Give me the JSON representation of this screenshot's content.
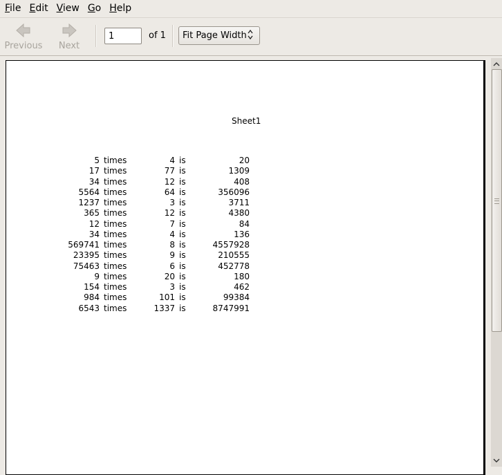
{
  "menu": {
    "items": [
      {
        "mnemonic": "F",
        "rest": "ile"
      },
      {
        "mnemonic": "E",
        "rest": "dit"
      },
      {
        "mnemonic": "V",
        "rest": "iew"
      },
      {
        "mnemonic": "G",
        "rest": "o"
      },
      {
        "mnemonic": "H",
        "rest": "elp"
      }
    ]
  },
  "toolbar": {
    "previous_label": "Previous",
    "next_label": "Next",
    "page_value": "1",
    "of_label": "of 1",
    "zoom_value": "Fit Page Width"
  },
  "document": {
    "sheet_title": "Sheet1",
    "rows": [
      {
        "a": "5",
        "times": "times",
        "b": "4",
        "is": "is",
        "result": "20"
      },
      {
        "a": "17",
        "times": "times",
        "b": "77",
        "is": "is",
        "result": "1309"
      },
      {
        "a": "34",
        "times": "times",
        "b": "12",
        "is": "is",
        "result": "408"
      },
      {
        "a": "5564",
        "times": "times",
        "b": "64",
        "is": "is",
        "result": "356096"
      },
      {
        "a": "1237",
        "times": "times",
        "b": "3",
        "is": "is",
        "result": "3711"
      },
      {
        "a": "365",
        "times": "times",
        "b": "12",
        "is": "is",
        "result": "4380"
      },
      {
        "a": "12",
        "times": "times",
        "b": "7",
        "is": "is",
        "result": "84"
      },
      {
        "a": "34",
        "times": "times",
        "b": "4",
        "is": "is",
        "result": "136"
      },
      {
        "a": "569741",
        "times": "times",
        "b": "8",
        "is": "is",
        "result": "4557928"
      },
      {
        "a": "23395",
        "times": "times",
        "b": "9",
        "is": "is",
        "result": "210555"
      },
      {
        "a": "75463",
        "times": "times",
        "b": "6",
        "is": "is",
        "result": "452778"
      },
      {
        "a": "9",
        "times": "times",
        "b": "20",
        "is": "is",
        "result": "180"
      },
      {
        "a": "154",
        "times": "times",
        "b": "3",
        "is": "is",
        "result": "462"
      },
      {
        "a": "984",
        "times": "times",
        "b": "101",
        "is": "is",
        "result": "99384"
      },
      {
        "a": "6543",
        "times": "times",
        "b": "1337",
        "is": "is",
        "result": "8747991"
      }
    ]
  },
  "icons": {
    "previous": "arrow-left-icon",
    "next": "arrow-right-icon",
    "scroll_up": "chevron-up-icon",
    "scroll_down": "chevron-down-icon",
    "zoom_arrows": "select-arrows-icon"
  },
  "colors": {
    "chrome_bg": "#edeae5",
    "disabled_text": "#a8a49d",
    "page_bg": "#ffffff"
  }
}
